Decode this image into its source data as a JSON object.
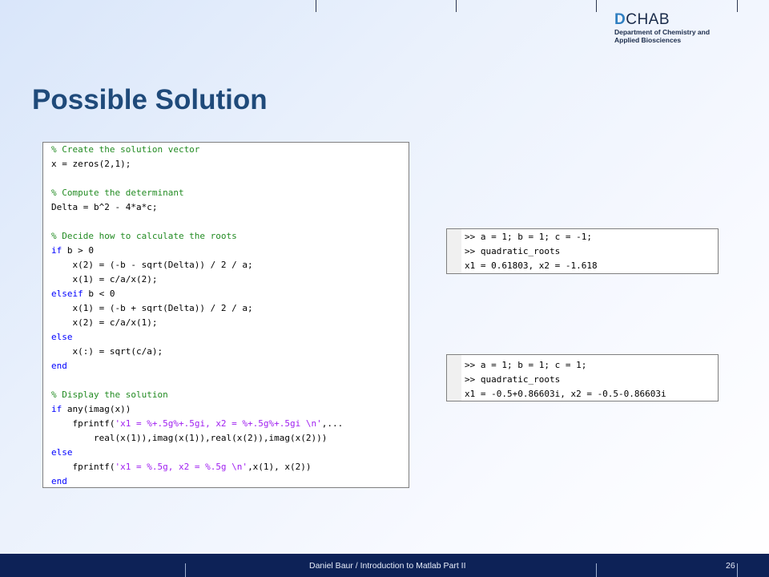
{
  "header": {
    "logo": {
      "mark_d": "D",
      "mark_rest": "CHAB",
      "line1": "Department of Chemistry and",
      "line2": "Applied Biosciences"
    }
  },
  "slide": {
    "title": "Possible Solution",
    "code": [
      {
        "text": "% Create the solution vector",
        "kind": "comment"
      },
      {
        "text": "x = zeros(2,1);",
        "kind": "code"
      },
      {
        "text": "",
        "kind": "code"
      },
      {
        "text": "% Compute the determinant",
        "kind": "comment"
      },
      {
        "text": "Delta = b^2 - 4*a*c;",
        "kind": "code"
      },
      {
        "text": "",
        "kind": "code"
      },
      {
        "text": "% Decide how to calculate the roots",
        "kind": "comment"
      },
      {
        "text": "if b > 0",
        "kind": "code"
      },
      {
        "text": "    x(2) = (-b - sqrt(Delta)) / 2 / a;",
        "kind": "code"
      },
      {
        "text": "    x(1) = c/a/x(2);",
        "kind": "code"
      },
      {
        "text": "elseif b < 0",
        "kind": "code"
      },
      {
        "text": "    x(1) = (-b + sqrt(Delta)) / 2 / a;",
        "kind": "code"
      },
      {
        "text": "    x(2) = c/a/x(1);",
        "kind": "code"
      },
      {
        "text": "else",
        "kind": "code"
      },
      {
        "text": "    x(:) = sqrt(c/a);",
        "kind": "code"
      },
      {
        "text": "end",
        "kind": "code"
      },
      {
        "text": "",
        "kind": "code"
      },
      {
        "text": "% Display the solution",
        "kind": "comment"
      },
      {
        "text": "if any(imag(x))",
        "kind": "code"
      },
      {
        "text": "    fprintf('x1 = %+.5g%+.5gi, x2 = %+.5g%+.5gi \\n',...",
        "kind": "code"
      },
      {
        "text": "        real(x(1)),imag(x(1)),real(x(2)),imag(x(2)))",
        "kind": "code"
      },
      {
        "text": "else",
        "kind": "code"
      },
      {
        "text": "    fprintf('x1 = %.5g, x2 = %.5g \\n',x(1), x(2))",
        "kind": "code"
      },
      {
        "text": "end",
        "kind": "code"
      }
    ],
    "console_real": [
      ">> a = 1; b = 1; c = -1;",
      ">> quadratic_roots",
      "x1 = 0.61803, x2 = -1.618"
    ],
    "console_complex": [
      ">> a = 1; b = 1; c = 1;",
      ">> quadratic_roots",
      "x1 = -0.5+0.86603i, x2 = -0.5-0.86603i"
    ]
  },
  "footer": {
    "text": "Daniel Baur / Introduction to Matlab Part II",
    "page_number": "26"
  },
  "colors": {
    "title": "#1f4a7a",
    "footer_bg": "#0d2257",
    "comment": "#228b22",
    "keyword": "#0000ff",
    "string": "#a020f0"
  }
}
